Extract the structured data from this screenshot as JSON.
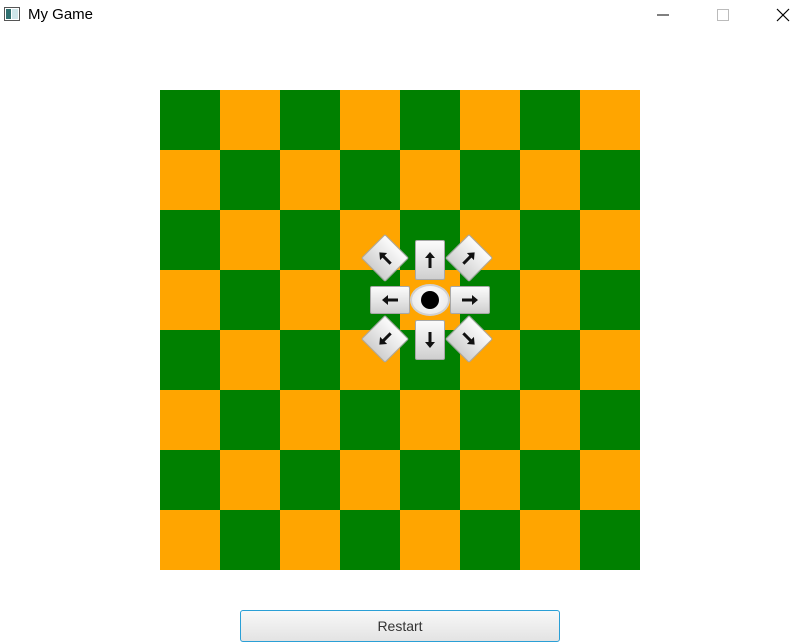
{
  "window": {
    "title": "My Game"
  },
  "colors": {
    "board_light": "#ffa500",
    "board_dark": "#008000",
    "focus": "#2a9fd6"
  },
  "board": {
    "rows": 8,
    "cols": 8,
    "first_square": "dark"
  },
  "direction_pad": {
    "buttons": [
      "up-left",
      "up",
      "up-right",
      "left",
      "center",
      "right",
      "down-left",
      "down",
      "down-right"
    ]
  },
  "controls": {
    "restart_label": "Restart"
  }
}
